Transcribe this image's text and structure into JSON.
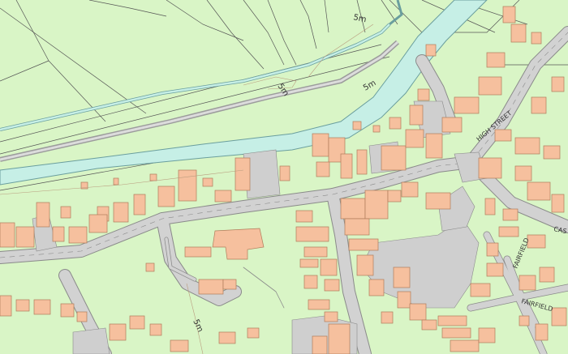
{
  "map": {
    "colors": {
      "land": "#d9f5c6",
      "river": "#c6efe6",
      "river_edge": "#6a9e9e",
      "road": "#d2d2d2",
      "road_edge": "#8a8a8a",
      "building": "#f6c09e",
      "building_edge": "#b07c5a",
      "paved": "#cfcfcf",
      "boundary": "#555555",
      "contour": "#b99c7e"
    },
    "labels": {
      "contour_ne": "5m",
      "contour_mid": "5m",
      "contour_river": "5m",
      "contour_south": "5m",
      "high_street": "HIGH STREET",
      "fairfield_1": "FAIRFIELD",
      "fairfield_2": "FAIRFIELD",
      "cas": "CAS"
    }
  }
}
